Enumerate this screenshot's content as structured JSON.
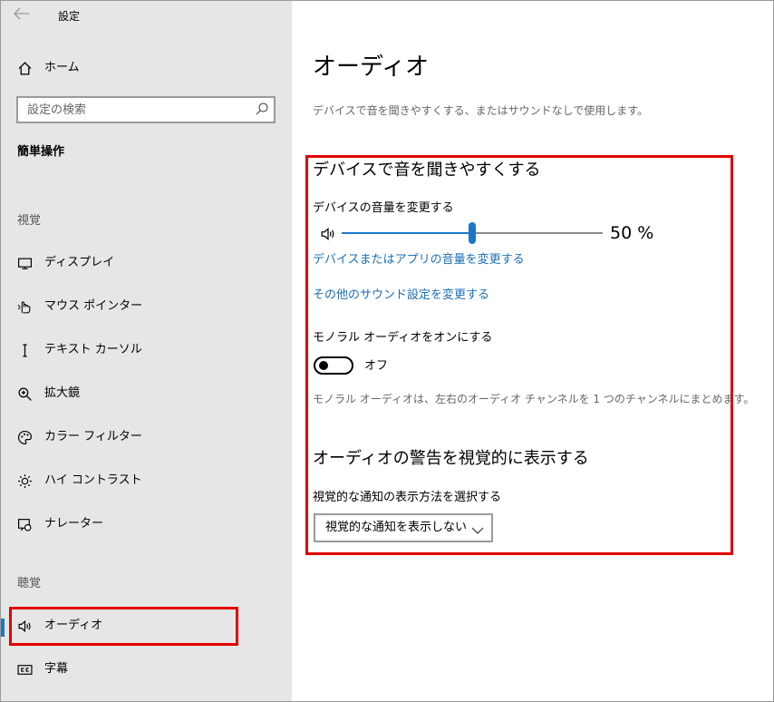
{
  "window": {
    "title": "設定"
  },
  "sidebar": {
    "home_label": "ホーム",
    "search_placeholder": "設定の検索",
    "section": "簡単操作",
    "groups": {
      "vision": "視覚",
      "hearing": "聴覚"
    },
    "items": [
      {
        "label": "ディスプレイ",
        "icon": "monitor-icon"
      },
      {
        "label": "マウス ポインター",
        "icon": "mouse-pointer-icon"
      },
      {
        "label": "テキスト カーソル",
        "icon": "text-cursor-icon"
      },
      {
        "label": "拡大鏡",
        "icon": "magnifier-icon"
      },
      {
        "label": "カラー フィルター",
        "icon": "color-palette-icon"
      },
      {
        "label": "ハイ コントラスト",
        "icon": "brightness-icon"
      },
      {
        "label": "ナレーター",
        "icon": "narrator-icon"
      },
      {
        "label": "オーディオ",
        "icon": "speaker-icon",
        "selected": true
      },
      {
        "label": "字幕",
        "icon": "closed-caption-icon"
      }
    ]
  },
  "content": {
    "title": "オーディオ",
    "description": "デバイスで音を聞きやすくする、またはサウンドなしで使用します。",
    "sections": {
      "hear_better": {
        "heading": "デバイスで音を聞きやすくする",
        "volume_label": "デバイスの音量を変更する",
        "volume_value": 50,
        "volume_readout": "50 %",
        "link_app_volume": "デバイスまたはアプリの音量を変更する",
        "link_other_sound": "その他のサウンド設定を変更する",
        "mono_label": "モノラル オーディオをオンにする",
        "mono_state": "オフ",
        "mono_on": false,
        "mono_note": "モノラル オーディオは、左右のオーディオ チャンネルを 1 つのチャンネルにまとめます。"
      },
      "visual_alerts": {
        "heading": "オーディオの警告を視覚的に表示する",
        "select_label": "視覚的な通知の表示方法を選択する",
        "select_value": "視覚的な通知を表示しない"
      }
    }
  },
  "colors": {
    "accent": "#1a77c9",
    "link": "#1a6fb5",
    "highlight": "#e00000",
    "sidebar_bg": "#e6e6e6"
  }
}
